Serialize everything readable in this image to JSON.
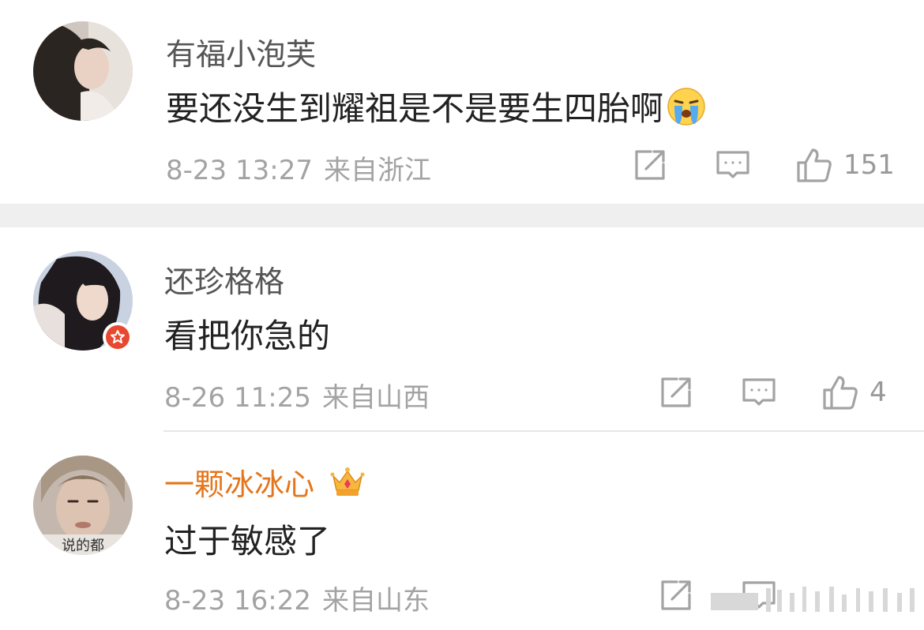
{
  "comments": [
    {
      "username": "有福小泡芙",
      "text": "要还没生到耀祖是不是要生四胎啊",
      "emoji": "crying-face",
      "date": "8-23 13:27",
      "location": "来自浙江",
      "likes": "151"
    },
    {
      "username": "还珍格格",
      "text": "看把你急的",
      "date": "8-26 11:25",
      "location": "来自山西",
      "likes": "4",
      "badge": "verified-star-badge"
    },
    {
      "username": "一颗冰冰心",
      "text": "过于敏感了",
      "date": "8-23 16:22",
      "location": "来自山东",
      "vip_badge": "crown-level-icon",
      "avatar_caption": "说的都"
    }
  ],
  "colors": {
    "username": "#555555",
    "vip_username": "#e3761c",
    "meta": "#a3a3a3",
    "separator": "#efefef",
    "badge": "#e8482f"
  }
}
